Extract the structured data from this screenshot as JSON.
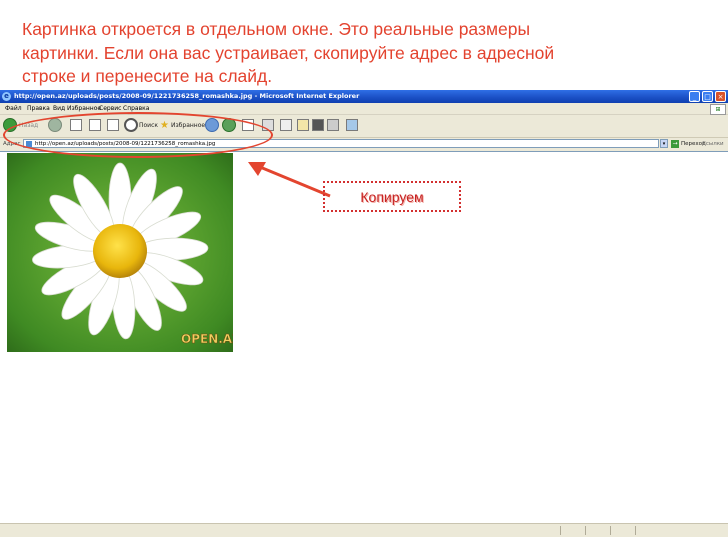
{
  "caption": "Картинка откроется в отдельном окне. Это реальные размеры\nкартинки. Если она вас устраивает, скопируйте адрес в адресной\nстроке и перенесите на слайд.",
  "browser": {
    "title": "http://open.az/uploads/posts/2008-09/1221736258_romashka.jpg - Microsoft Internet Explorer",
    "menu": [
      "Файл",
      "Правка",
      "Вид",
      "Избранное",
      "Сервис",
      "Справка"
    ],
    "toolbar": {
      "back_label": "Назад",
      "search_label": "Поиск",
      "favorites_label": "Избранное"
    },
    "address_label": "Адрес",
    "address_url": "http://open.az/uploads/posts/2008-09/1221736258_romashka.jpg",
    "go_label": "Переход",
    "links_label": "Ссылки",
    "image_watermark": "OPEN.AZ"
  },
  "annotation": {
    "copy_label": "Копируем"
  },
  "colors": {
    "caption_red": "#e3432f",
    "annotation_red": "#d32f2f"
  }
}
